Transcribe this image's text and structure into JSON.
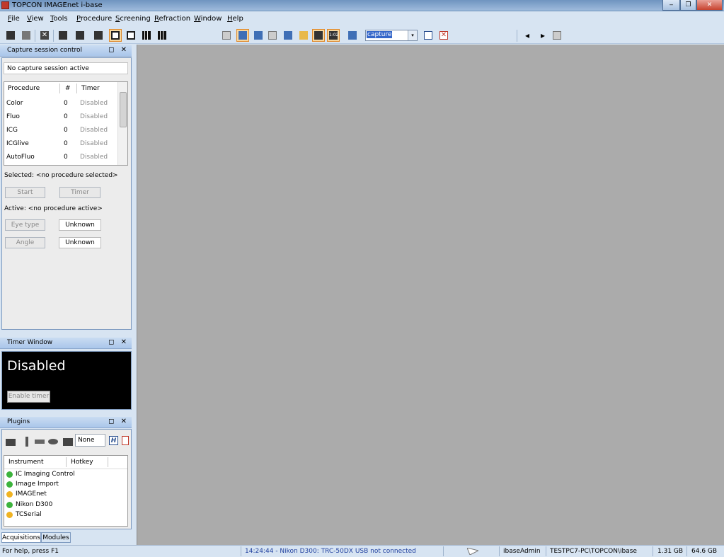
{
  "window": {
    "title": "TOPCON IMAGEnet i-base",
    "minimize": "‒",
    "maximize": "❐",
    "close": "✕"
  },
  "menubar": [
    {
      "label": "File",
      "underline": "F",
      "rest": "ile"
    },
    {
      "label": "View",
      "underline": "V",
      "rest": "iew"
    },
    {
      "label": "Tools",
      "underline": "T",
      "rest": "ools"
    },
    {
      "label": "Procedure",
      "underline": "P",
      "rest": "rocedure"
    },
    {
      "label": "Screening",
      "underline": "S",
      "rest": "creening"
    },
    {
      "label": "Refraction",
      "underline": "R",
      "rest": "efraction"
    },
    {
      "label": "Window",
      "underline": "W",
      "rest": "indow"
    },
    {
      "label": "Help",
      "underline": "H",
      "rest": "elp"
    }
  ],
  "toolbar": {
    "capture_value": "capture",
    "capture_arrow": "▾",
    "nav_prev": "◂",
    "nav_next": "▸",
    "grid_icons": [
      "1:02"
    ]
  },
  "capture_session": {
    "title": "Capture session control",
    "status": "No capture session active",
    "columns": [
      "Procedure",
      "#",
      "Timer"
    ],
    "rows": [
      {
        "procedure": "Color",
        "count": "0",
        "timer": "Disabled"
      },
      {
        "procedure": "Fluo",
        "count": "0",
        "timer": "Disabled"
      },
      {
        "procedure": "ICG",
        "count": "0",
        "timer": "Disabled"
      },
      {
        "procedure": "ICGlive",
        "count": "0",
        "timer": "Disabled"
      },
      {
        "procedure": "AutoFluo",
        "count": "0",
        "timer": "Disabled"
      }
    ],
    "selected_label": "Selected: <no procedure selected>",
    "start_label": "Start",
    "timer_label": "Timer",
    "active_label": "Active: <no procedure active>",
    "eye_type_label": "Eye type",
    "eye_type_value": "Unknown",
    "angle_label": "Angle",
    "angle_value": "Unknown"
  },
  "timer_window": {
    "title": "Timer Window",
    "state": "Disabled",
    "enable_label": "Enable timer"
  },
  "plugins": {
    "title": "Plugins",
    "selector_value": "None",
    "columns": [
      "Instrument",
      "Hotkey"
    ],
    "instruments": [
      {
        "name": "IC Imaging Control",
        "status_color": "#3db33d"
      },
      {
        "name": "Image Import",
        "status_color": "#3db33d"
      },
      {
        "name": "IMAGEnet",
        "status_color": "#f0b323"
      },
      {
        "name": "Nikon D300",
        "status_color": "#3db33d"
      },
      {
        "name": "TCSerial",
        "status_color": "#f0b323"
      }
    ]
  },
  "dock_tabs": [
    "Acquisitions",
    "Modules"
  ],
  "panel_controls": "◻ ✕",
  "statusbar": {
    "help": "For help, press F1",
    "message": "14:24:44 - Nikon D300: TRC-50DX USB not connected",
    "user": "ibaseAdmin",
    "path": "TESTPC7-PC\\TOPCON\\ibase",
    "mem1": "1.31 GB",
    "mem2": "64.6 GB"
  }
}
